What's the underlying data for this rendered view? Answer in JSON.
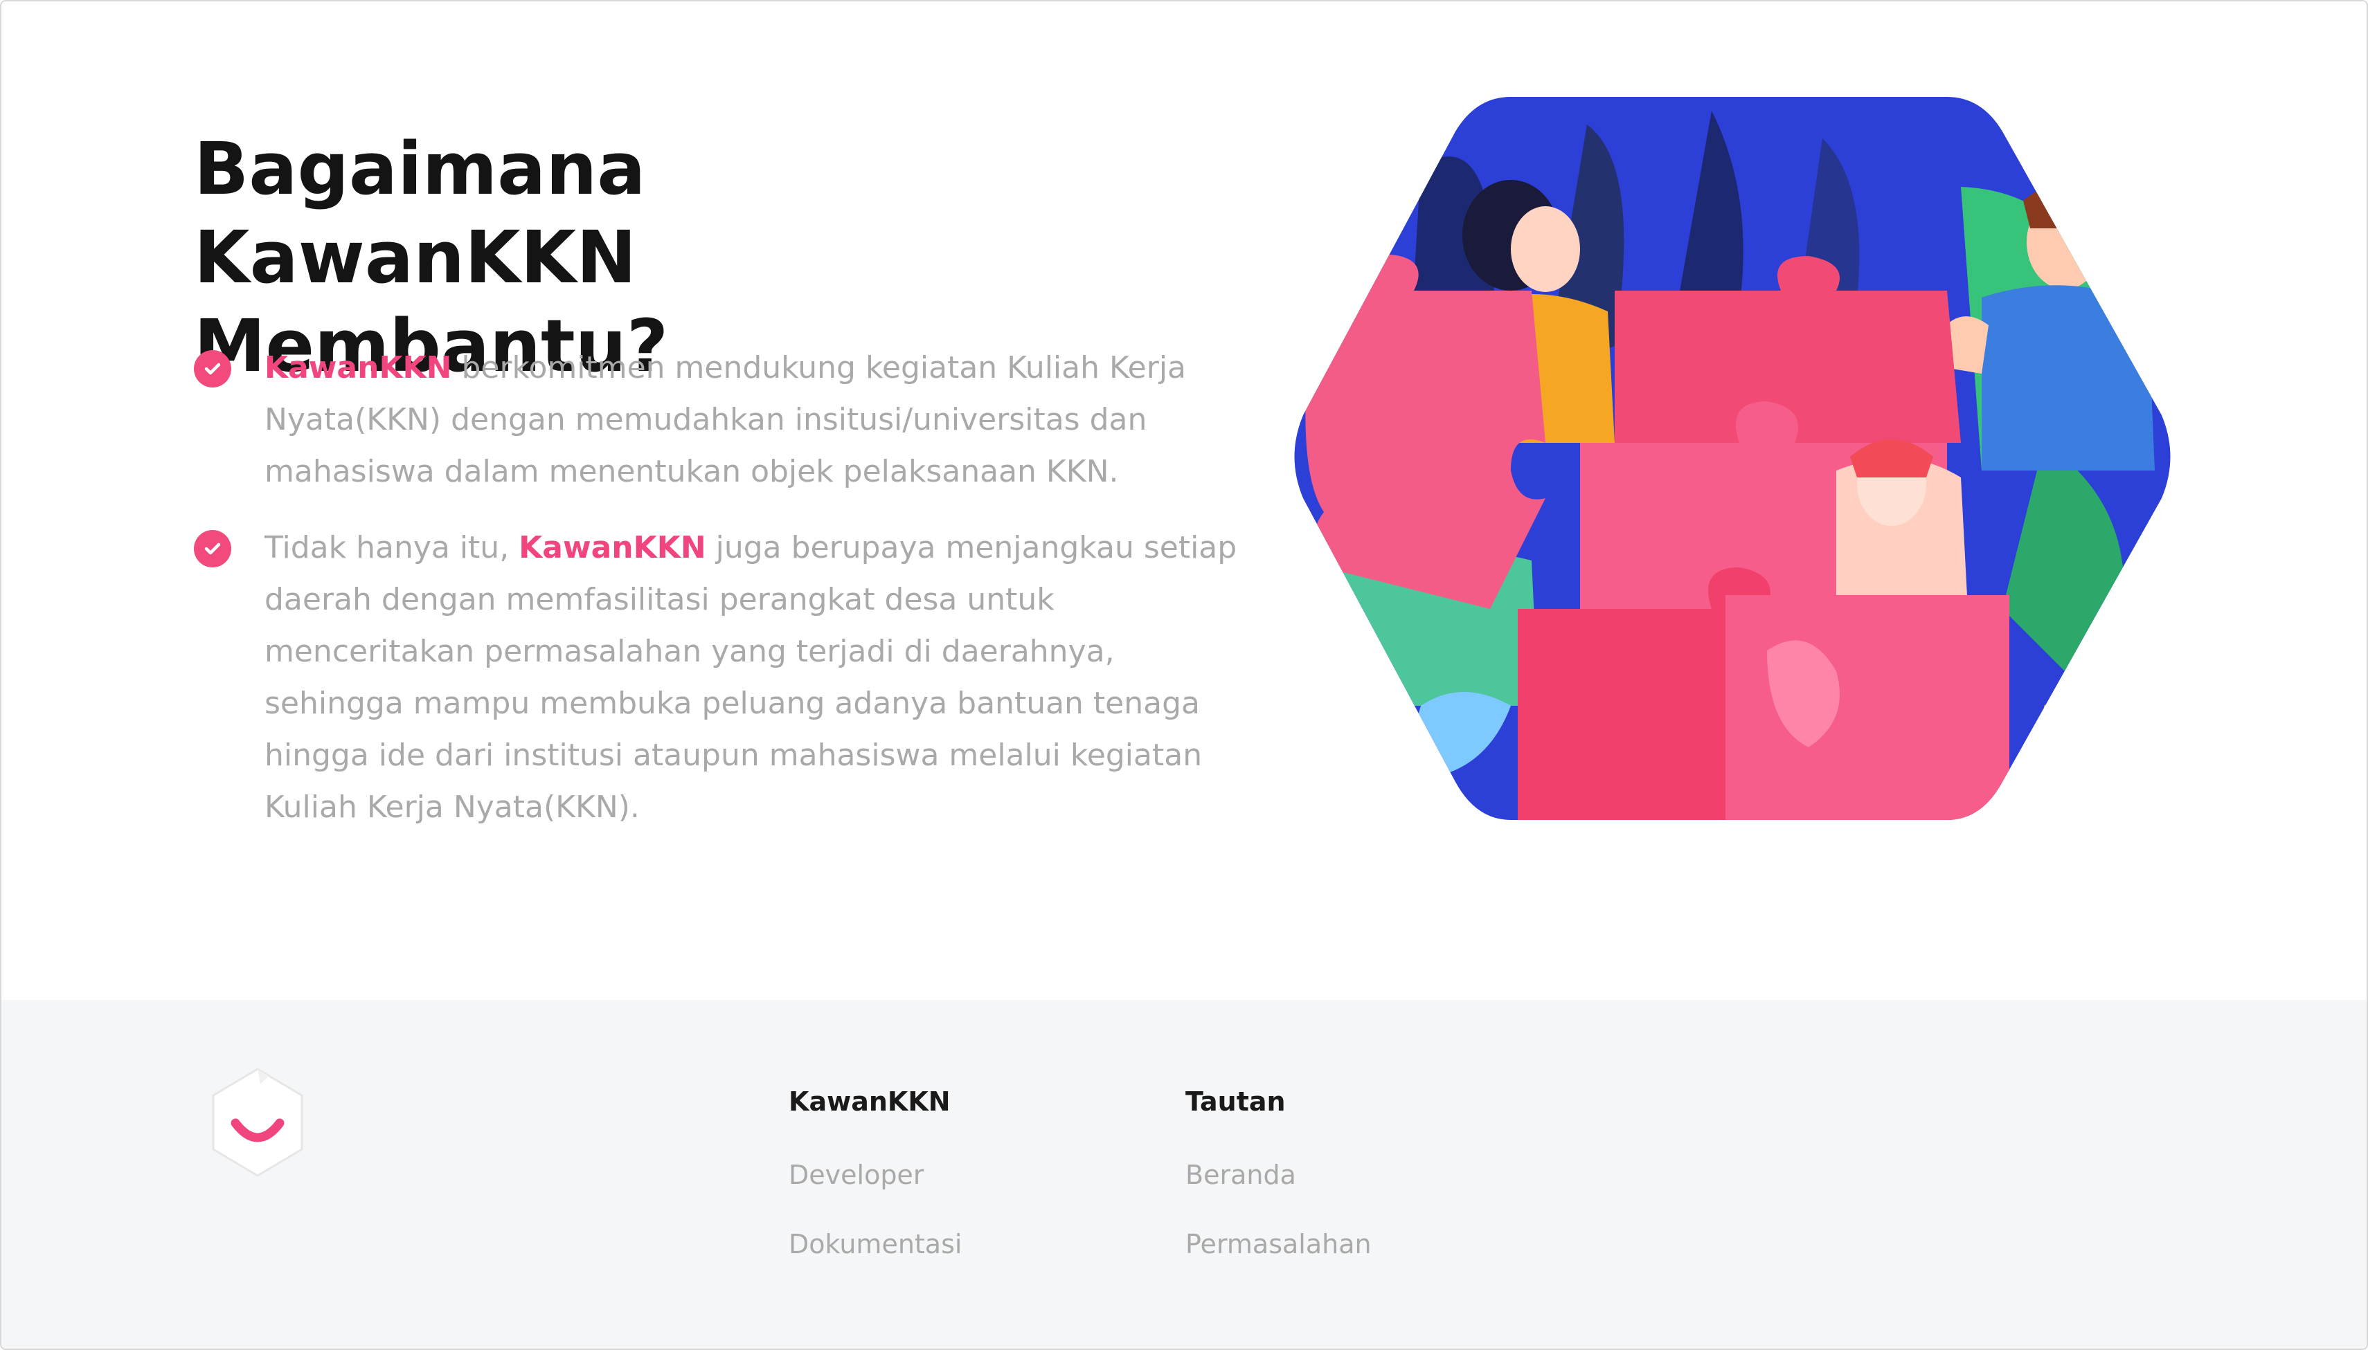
{
  "section": {
    "title": "Bagaimana KawanKKN Membantu?",
    "title_line1": "Bagaimana KawanKKN",
    "title_line2": "Membantu?",
    "points": [
      {
        "pre": "",
        "highlight": "KawanKKN",
        "post": " berkomitmen mendukung kegiatan Kuliah Kerja Nyata(KKN) dengan memudahkan insitusi/universitas dan mahasiswa dalam menentukan objek pelaksanaan KKN."
      },
      {
        "pre": "Tidak hanya itu, ",
        "highlight": "KawanKKN",
        "post": " juga berupaya menjangkau setiap daerah dengan memfasilitasi perangkat desa untuk menceritakan permasalahan yang terjadi di daerahnya, sehingga mampu membuka peluang adanya bantuan tenaga hingga ide dari institusi ataupun mahasiswa melalui kegiatan Kuliah Kerja Nyata(KKN)."
      }
    ],
    "check_icon": "check-circle-icon",
    "illustration": "puzzle-team-illustration"
  },
  "footer": {
    "logo": "kawankkn-smile-logo",
    "columns": [
      {
        "heading": "KawanKKN",
        "links": [
          "Developer",
          "Dokumentasi"
        ]
      },
      {
        "heading": "Tautan",
        "links": [
          "Beranda",
          "Permasalahan"
        ]
      }
    ]
  },
  "colors": {
    "accent": "#f0467d",
    "text_muted": "#a9a9a9",
    "heading": "#141414",
    "footer_bg": "#f5f6f7"
  }
}
